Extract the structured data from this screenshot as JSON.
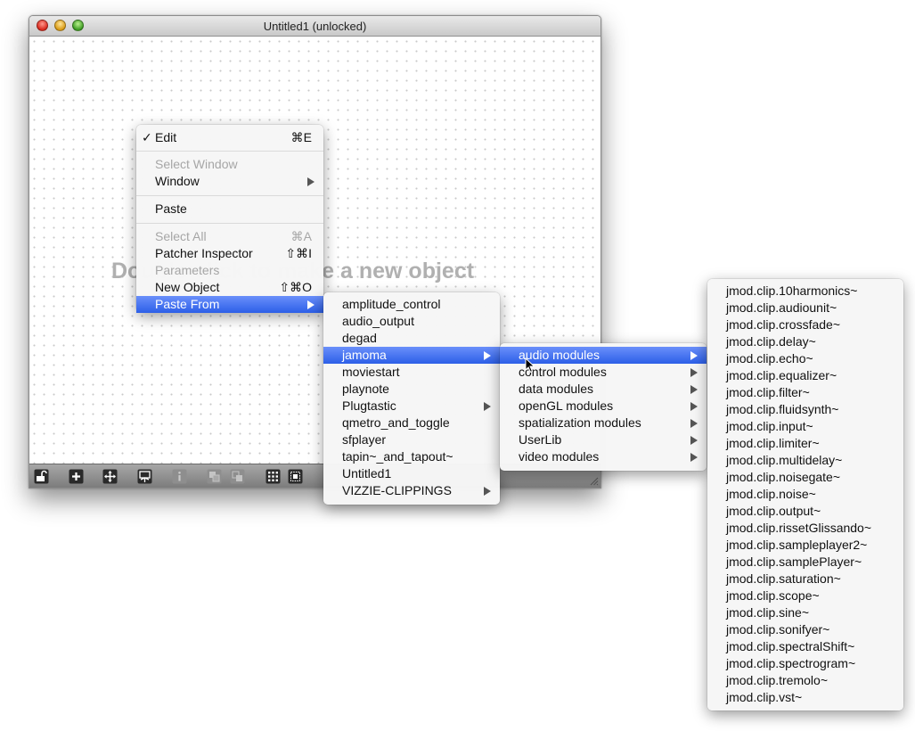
{
  "window": {
    "title": "Untitled1 (unlocked)"
  },
  "canvas": {
    "hint": "Double-click to make a new object"
  },
  "toolbar": {
    "buttons": [
      "lock-icon",
      "add-icon",
      "move-icon",
      "presentation-icon",
      "info-icon",
      "group-icon",
      "ungroup-icon",
      "grid-icon",
      "snap-grid-icon"
    ]
  },
  "context_menu": {
    "items": [
      {
        "label": "Edit",
        "checked": true,
        "shortcut": "⌘E"
      },
      {
        "label": "Select Window",
        "disabled": true
      },
      {
        "label": "Window",
        "submenu": true
      },
      {
        "label": "Paste"
      },
      {
        "label": "Select All",
        "disabled": true,
        "shortcut": "⌘A"
      },
      {
        "label": "Patcher Inspector",
        "shortcut": "⇧⌘I"
      },
      {
        "label": "Parameters",
        "disabled": true
      },
      {
        "label": "New Object",
        "shortcut": "⇧⌘O"
      },
      {
        "label": "Paste From",
        "submenu": true,
        "highlighted": true
      }
    ]
  },
  "paste_from_menu": {
    "items": [
      "amplitude_control",
      "audio_output",
      "degad",
      "jamoma",
      "moviestart",
      "playnote",
      "Plugtastic",
      "qmetro_and_toggle",
      "sfplayer",
      "tapin~_and_tapout~",
      "Untitled1",
      "VIZZIE-CLIPPINGS"
    ],
    "highlighted": "jamoma"
  },
  "jamoma_menu": {
    "items": [
      "audio modules",
      "control modules",
      "data modules",
      "openGL modules",
      "spatialization modules",
      "UserLib",
      "video modules"
    ],
    "highlighted": "audio modules"
  },
  "audio_modules_menu": {
    "items": [
      "jmod.clip.10harmonics~",
      "jmod.clip.audiounit~",
      "jmod.clip.crossfade~",
      "jmod.clip.delay~",
      "jmod.clip.echo~",
      "jmod.clip.equalizer~",
      "jmod.clip.filter~",
      "jmod.clip.fluidsynth~",
      "jmod.clip.input~",
      "jmod.clip.limiter~",
      "jmod.clip.multidelay~",
      "jmod.clip.noisegate~",
      "jmod.clip.noise~",
      "jmod.clip.output~",
      "jmod.clip.rissetGlissando~",
      "jmod.clip.sampleplayer2~",
      "jmod.clip.samplePlayer~",
      "jmod.clip.saturation~",
      "jmod.clip.scope~",
      "jmod.clip.sine~",
      "jmod.clip.sonifyer~",
      "jmod.clip.spectralShift~",
      "jmod.clip.spectrogram~",
      "jmod.clip.tremolo~",
      "jmod.clip.vst~"
    ]
  },
  "colors": {
    "highlight": "#3b6cf0",
    "menu_bg": "#f6f6f6",
    "hint_text": "#b0b0b0"
  }
}
